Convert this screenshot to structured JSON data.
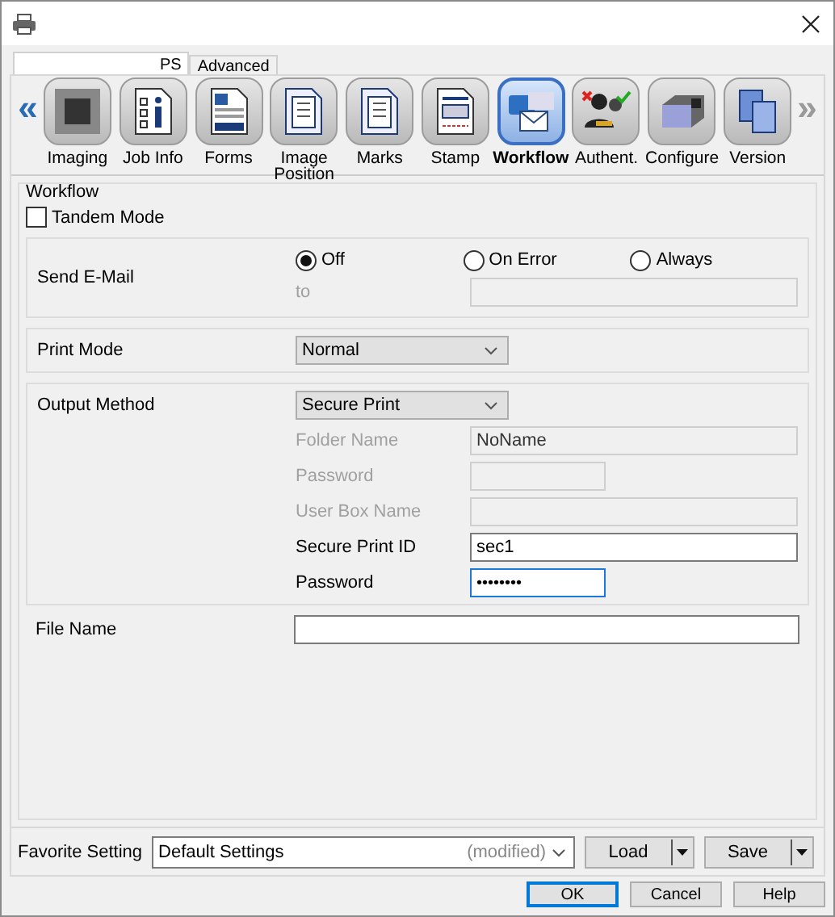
{
  "driver_tabs": [
    {
      "label": "PS",
      "selected": true
    },
    {
      "label": "Advanced",
      "selected": false
    }
  ],
  "toolbar": {
    "prev": {
      "glyph": "«",
      "disabled": false
    },
    "next": {
      "glyph": "»",
      "disabled": true
    },
    "items": [
      {
        "label": "Imaging",
        "selected": false
      },
      {
        "label": "Job Info",
        "selected": false
      },
      {
        "label": "Forms",
        "selected": false
      },
      {
        "label": "Image Position",
        "selected": false
      },
      {
        "label": "Marks",
        "selected": false
      },
      {
        "label": "Stamp",
        "selected": false
      },
      {
        "label": "Workflow",
        "selected": true
      },
      {
        "label": "Authent.",
        "selected": false
      },
      {
        "label": "Configure",
        "selected": false
      },
      {
        "label": "Version",
        "selected": false
      }
    ]
  },
  "workflow": {
    "title": "Workflow",
    "tandem": {
      "label": "Tandem Mode",
      "checked": false
    },
    "send_email": {
      "label": "Send E-Mail",
      "options": [
        {
          "label": "Off",
          "selected": true
        },
        {
          "label": "On Error",
          "selected": false
        },
        {
          "label": "Always",
          "selected": false
        }
      ],
      "to": {
        "label": "to",
        "disabled": true
      }
    },
    "print_mode": {
      "label": "Print Mode",
      "value": "Normal"
    },
    "output_method": {
      "label": "Output Method",
      "value": "Secure Print",
      "fields": [
        {
          "label": "Folder Name",
          "kind": "text",
          "value": "NoName",
          "disabled": true,
          "focused": false
        },
        {
          "label": "Password",
          "kind": "password",
          "disabled": true,
          "focused": false
        },
        {
          "label": "User Box Name",
          "kind": "text",
          "disabled": true,
          "focused": false
        },
        {
          "label": "Secure Print ID",
          "kind": "text",
          "value": "sec1",
          "disabled": false,
          "focused": false
        },
        {
          "label": "Password",
          "kind": "password",
          "value": "••••••••",
          "disabled": false,
          "focused": true
        }
      ]
    },
    "file_name": {
      "label": "File Name"
    }
  },
  "favorite": {
    "label": "Favorite Setting",
    "value": "Default Settings",
    "note": "(modified)",
    "buttons": [
      "Load",
      "Save"
    ]
  },
  "footer_buttons": [
    {
      "label": "OK",
      "default": true
    },
    {
      "label": "Cancel",
      "default": false
    },
    {
      "label": "Help",
      "default": false
    }
  ]
}
